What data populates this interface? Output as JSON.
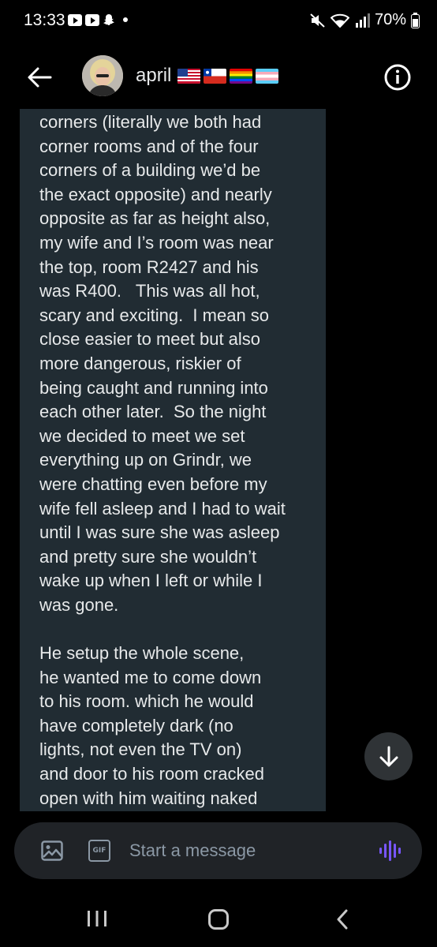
{
  "status_bar": {
    "time": "13:33",
    "battery": "70%"
  },
  "header": {
    "contact_name": "april",
    "flags": [
      "us-flag",
      "chile-flag",
      "rainbow-flag",
      "trans-flag"
    ]
  },
  "message": {
    "text": "corners (literally we both had\ncorner rooms and of the four\ncorners of a building we’d be\nthe exact opposite) and nearly\nopposite as far as height also,\nmy wife and I’s room was near\nthe top, room R2427 and his\nwas R400.   This was all hot,\nscary and exciting.  I mean so\nclose easier to meet but also\nmore dangerous, riskier of\nbeing caught and running into\neach other later.  So the night\nwe decided to meet we set\neverything up on Grindr, we\nwere chatting even before my\nwife fell asleep and I had to wait\nuntil I was sure she was asleep\nand pretty sure she wouldn’t\nwake up when I left or while I\nwas gone.\n\nHe setup the whole scene,\nhe wanted me to come down\nto his room. which he would\nhave completely dark (no\nlights, not even the TV on)\nand door to his room cracked\nopen with him waiting naked"
  },
  "composer": {
    "placeholder": "Start a message",
    "value": "",
    "gif_label": "GIF"
  },
  "colors": {
    "bubble": "#212c33",
    "accent_voice": "#7856ff",
    "composer_bg": "#202327"
  }
}
